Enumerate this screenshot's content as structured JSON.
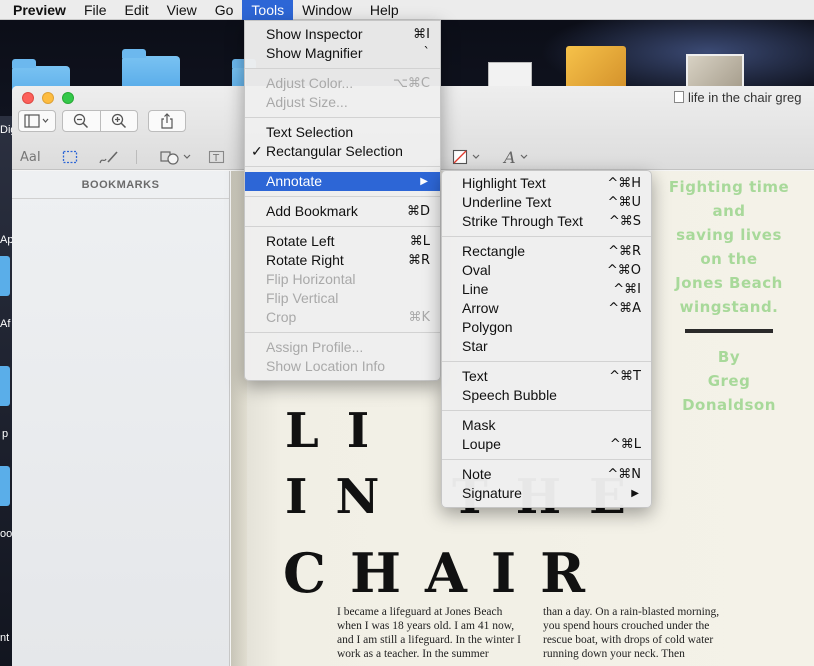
{
  "menubar": {
    "app": "Preview",
    "items": [
      "File",
      "Edit",
      "View",
      "Go",
      "Tools",
      "Window",
      "Help"
    ],
    "active": "Tools"
  },
  "window": {
    "title": "life in the chair greg",
    "sidebar_header": "BOOKMARKS"
  },
  "tools_menu": [
    {
      "label": "Show Inspector",
      "shortcut": "⌘I",
      "enabled": true
    },
    {
      "label": "Show Magnifier",
      "shortcut": "`",
      "enabled": true
    },
    {
      "sep": true
    },
    {
      "label": "Adjust Color...",
      "shortcut": "⌥⌘C",
      "enabled": false
    },
    {
      "label": "Adjust Size...",
      "shortcut": "",
      "enabled": false
    },
    {
      "sep": true
    },
    {
      "label": "Text Selection",
      "shortcut": "",
      "enabled": true
    },
    {
      "label": "Rectangular Selection",
      "shortcut": "",
      "enabled": true,
      "checked": true
    },
    {
      "sep": true
    },
    {
      "label": "Annotate",
      "shortcut": "",
      "enabled": true,
      "submenu": true,
      "highlighted": true
    },
    {
      "sep": true
    },
    {
      "label": "Add Bookmark",
      "shortcut": "⌘D",
      "enabled": true
    },
    {
      "sep": true
    },
    {
      "label": "Rotate Left",
      "shortcut": "⌘L",
      "enabled": true
    },
    {
      "label": "Rotate Right",
      "shortcut": "⌘R",
      "enabled": true
    },
    {
      "label": "Flip Horizontal",
      "shortcut": "",
      "enabled": false
    },
    {
      "label": "Flip Vertical",
      "shortcut": "",
      "enabled": false
    },
    {
      "label": "Crop",
      "shortcut": "⌘K",
      "enabled": false
    },
    {
      "sep": true
    },
    {
      "label": "Assign Profile...",
      "shortcut": "",
      "enabled": false
    },
    {
      "label": "Show Location Info",
      "shortcut": "",
      "enabled": false
    }
  ],
  "annotate_menu": [
    {
      "label": "Highlight Text",
      "shortcut": "^⌘H"
    },
    {
      "label": "Underline Text",
      "shortcut": "^⌘U"
    },
    {
      "label": "Strike Through Text",
      "shortcut": "^⌘S"
    },
    {
      "sep": true
    },
    {
      "label": "Rectangle",
      "shortcut": "^⌘R"
    },
    {
      "label": "Oval",
      "shortcut": "^⌘O"
    },
    {
      "label": "Line",
      "shortcut": "^⌘I"
    },
    {
      "label": "Arrow",
      "shortcut": "^⌘A"
    },
    {
      "label": "Polygon",
      "shortcut": ""
    },
    {
      "label": "Star",
      "shortcut": ""
    },
    {
      "sep": true
    },
    {
      "label": "Text",
      "shortcut": "^⌘T"
    },
    {
      "label": "Speech Bubble",
      "shortcut": ""
    },
    {
      "sep": true
    },
    {
      "label": "Mask",
      "shortcut": ""
    },
    {
      "label": "Loupe",
      "shortcut": "^⌘L"
    },
    {
      "sep": true
    },
    {
      "label": "Note",
      "shortcut": "^⌘N"
    },
    {
      "label": "Signature",
      "shortcut": "",
      "submenu": true
    }
  ],
  "document": {
    "green_lines": [
      "Fighting time",
      "and",
      "saving lives",
      "on the",
      "Jones Beach",
      "wingstand."
    ],
    "byline": [
      "By",
      "Greg",
      "Donaldson"
    ],
    "headline": [
      "LI",
      "IN THE",
      "CHAIR"
    ],
    "col1": "I became a lifeguard at Jones Beach when I was 18 years old. I am 41 now, and I am still a lifeguard. In the winter I work as a teacher. In the summer",
    "col2": "than a day. On a rain-blasted morning, you spend hours crouched under the rescue boat, with drops of cold water running down your neck. Then"
  },
  "desktop": {
    "side_labels": [
      "Dig",
      "Ap",
      "Af",
      "p",
      "oo",
      "nt"
    ]
  },
  "icons": {
    "sidebar_toggle": "sidebar-icon",
    "zoom_out": "zoom-out-icon",
    "zoom_in": "zoom-in-icon",
    "share": "share-icon",
    "text_tool": "text-tool-icon",
    "rect_select": "rect-select-icon",
    "sketch": "sketch-icon",
    "shapes": "shapes-icon",
    "textbox": "textbox-icon",
    "border_color": "border-color-icon",
    "font": "font-icon"
  },
  "colors": {
    "accent": "#2d66d6",
    "green_text": "#a8d99a"
  }
}
